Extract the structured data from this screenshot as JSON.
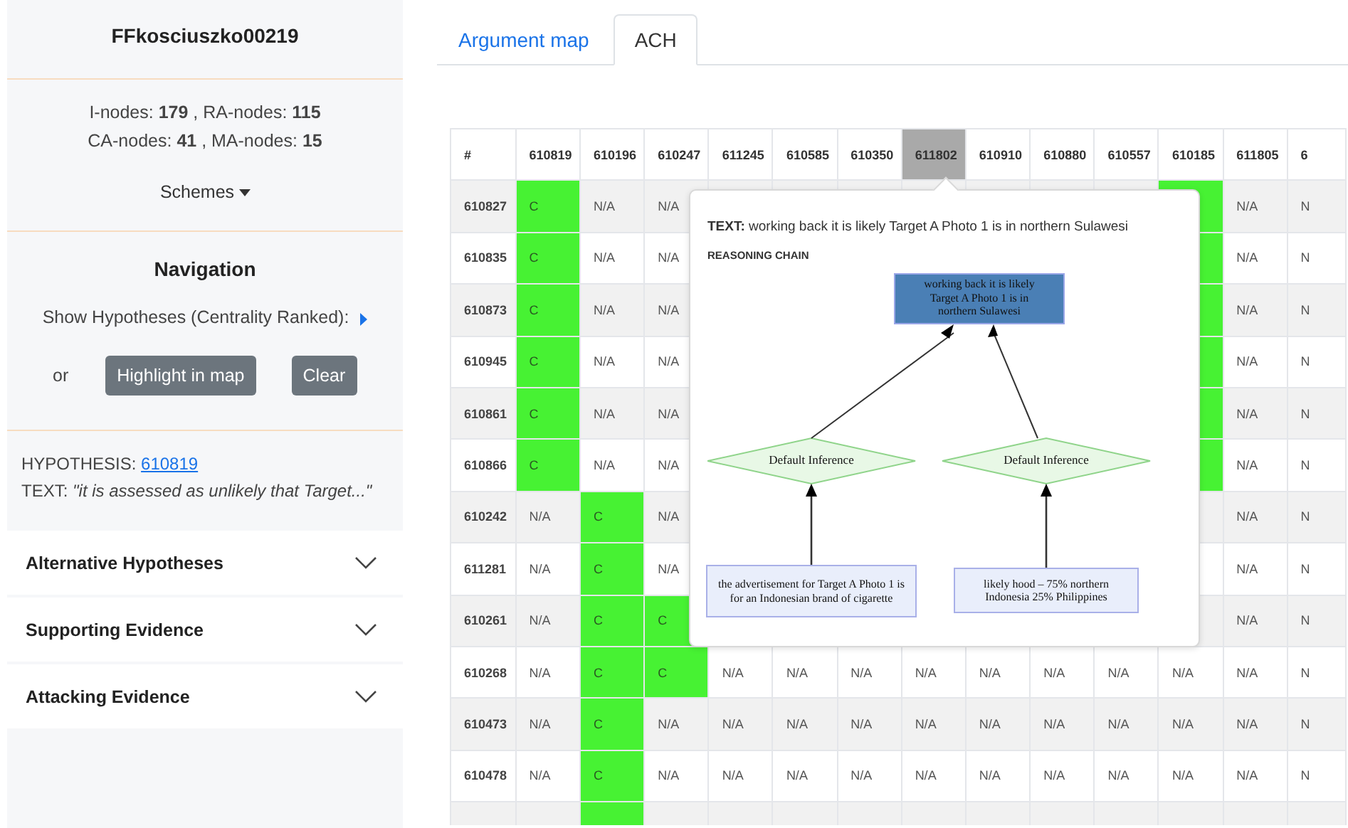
{
  "sidebar": {
    "title": "FFkosciuszko00219",
    "stats": [
      "I-nodes: **179** , RA-nodes: **115**",
      "CA-nodes: **41** , MA-nodes: **15**"
    ],
    "schemes_label": "Schemes",
    "navigation": {
      "heading": "Navigation",
      "show_label": "Show Hypotheses (Centrality Ranked):",
      "or_label": "or",
      "buttons": [
        "Highlight in map",
        "Clear"
      ]
    },
    "hypothesis": {
      "label": "HYPOTHESIS:",
      "id": "610819",
      "text": "TEXT: *\"it is assessed as unlikely that Target...\"*"
    },
    "accordion": [
      {
        "title": "Alternative Hypotheses",
        "expanded": false
      },
      {
        "title": "Supporting Evidence",
        "expanded": false
      },
      {
        "title": "Attacking Evidence",
        "expanded": false
      }
    ]
  },
  "tabs": [
    {
      "label": "Argument map",
      "selected": false
    },
    {
      "label": "ACH",
      "selected": true
    }
  ],
  "ach_table": {
    "corner_label": "#",
    "columns": [
      {
        "label": "610819",
        "selected": false
      },
      {
        "label": "610196",
        "selected": false
      },
      {
        "label": "610247",
        "selected": false
      },
      {
        "label": "611245",
        "selected": false
      },
      {
        "label": "610585",
        "selected": false
      },
      {
        "label": "610350",
        "selected": false
      },
      {
        "label": "611802",
        "selected": true
      },
      {
        "label": "610910",
        "selected": false
      },
      {
        "label": "610880",
        "selected": false
      },
      {
        "label": "610557",
        "selected": false
      },
      {
        "label": "610185",
        "selected": false
      },
      {
        "label": "611805",
        "selected": false
      },
      {
        "label": "6",
        "selected": false
      }
    ],
    "rows": [
      {
        "id": "610827",
        "cells": [
          {
            "text": "C",
            "match": true
          },
          {
            "text": "N/A",
            "match": false
          },
          {
            "text": "N/A",
            "match": false
          },
          null,
          null,
          null,
          null,
          null,
          null,
          null,
          {
            "match": true
          },
          {
            "text": "N/A",
            "match": false
          },
          {
            "text": "N",
            "match": false
          }
        ]
      },
      {
        "id": "610835",
        "cells": [
          {
            "text": "C",
            "match": true
          },
          {
            "text": "N/A",
            "match": false
          },
          {
            "text": "N/A",
            "match": false
          },
          null,
          null,
          null,
          null,
          null,
          null,
          null,
          {
            "match": true
          },
          {
            "text": "N/A",
            "match": false
          },
          {
            "text": "N",
            "match": false
          }
        ]
      },
      {
        "id": "610873",
        "cells": [
          {
            "text": "C",
            "match": true
          },
          {
            "text": "N/A",
            "match": false
          },
          {
            "text": "N/A",
            "match": false
          },
          null,
          null,
          null,
          null,
          null,
          null,
          null,
          {
            "match": true
          },
          {
            "text": "N/A",
            "match": false
          },
          {
            "text": "N",
            "match": false
          }
        ]
      },
      {
        "id": "610945",
        "cells": [
          {
            "text": "C",
            "match": true
          },
          {
            "text": "N/A",
            "match": false
          },
          {
            "text": "N/A",
            "match": false
          },
          null,
          null,
          null,
          null,
          null,
          null,
          null,
          {
            "match": true
          },
          {
            "text": "N/A",
            "match": false
          },
          {
            "text": "N",
            "match": false
          }
        ]
      },
      {
        "id": "610861",
        "cells": [
          {
            "text": "C",
            "match": true
          },
          {
            "text": "N/A",
            "match": false
          },
          {
            "text": "N/A",
            "match": false
          },
          null,
          null,
          null,
          null,
          null,
          null,
          null,
          {
            "match": true
          },
          {
            "text": "N/A",
            "match": false
          },
          {
            "text": "N",
            "match": false
          }
        ]
      },
      {
        "id": "610866",
        "cells": [
          {
            "text": "C",
            "match": true
          },
          {
            "text": "N/A",
            "match": false
          },
          {
            "text": "N/A",
            "match": false
          },
          null,
          null,
          null,
          null,
          null,
          null,
          null,
          {
            "match": true
          },
          {
            "text": "N/A",
            "match": false
          },
          {
            "text": "N",
            "match": false
          }
        ]
      },
      {
        "id": "610242",
        "cells": [
          {
            "text": "N/A",
            "match": false
          },
          {
            "text": "C",
            "match": true
          },
          {
            "text": "N/A",
            "match": false
          },
          null,
          null,
          null,
          null,
          null,
          null,
          null,
          null,
          {
            "text": "N/A",
            "match": false
          },
          {
            "text": "N",
            "match": false
          }
        ]
      },
      {
        "id": "611281",
        "cells": [
          {
            "text": "N/A",
            "match": false
          },
          {
            "text": "C",
            "match": true
          },
          {
            "text": "N/A",
            "match": false
          },
          null,
          null,
          null,
          null,
          null,
          null,
          null,
          null,
          {
            "text": "N/A",
            "match": false
          },
          {
            "text": "N",
            "match": false
          }
        ]
      },
      {
        "id": "610261",
        "cells": [
          {
            "text": "N/A",
            "match": false
          },
          {
            "text": "C",
            "match": true
          },
          {
            "text": "C",
            "match": true
          },
          null,
          null,
          null,
          null,
          null,
          null,
          null,
          null,
          {
            "text": "N/A",
            "match": false
          },
          {
            "text": "N",
            "match": false
          }
        ]
      },
      {
        "id": "610268",
        "cells": [
          {
            "text": "N/A",
            "match": false
          },
          {
            "text": "C",
            "match": true
          },
          {
            "text": "C",
            "match": true
          },
          {
            "text": "N/A",
            "match": false
          },
          {
            "text": "N/A",
            "match": false
          },
          {
            "text": "N/A",
            "match": false
          },
          {
            "text": "N/A",
            "match": false
          },
          {
            "text": "N/A",
            "match": false
          },
          {
            "text": "N/A",
            "match": false
          },
          {
            "text": "N/A",
            "match": false
          },
          {
            "text": "N/A",
            "match": false
          },
          {
            "text": "N/A",
            "match": false
          },
          {
            "text": "N",
            "match": false
          }
        ]
      },
      {
        "id": "610473",
        "cells": [
          {
            "text": "N/A",
            "match": false
          },
          {
            "text": "C",
            "match": true
          },
          {
            "text": "N/A",
            "match": false
          },
          {
            "text": "N/A",
            "match": false
          },
          {
            "text": "N/A",
            "match": false
          },
          {
            "text": "N/A",
            "match": false
          },
          {
            "text": "N/A",
            "match": false
          },
          {
            "text": "N/A",
            "match": false
          },
          {
            "text": "N/A",
            "match": false
          },
          {
            "text": "N/A",
            "match": false
          },
          {
            "text": "N/A",
            "match": false
          },
          {
            "text": "N/A",
            "match": false
          },
          {
            "text": "N",
            "match": false
          }
        ]
      },
      {
        "id": "610478",
        "cells": [
          {
            "text": "N/A",
            "match": false
          },
          {
            "text": "C",
            "match": true
          },
          {
            "text": "N/A",
            "match": false
          },
          {
            "text": "N/A",
            "match": false
          },
          {
            "text": "N/A",
            "match": false
          },
          {
            "text": "N/A",
            "match": false
          },
          {
            "text": "N/A",
            "match": false
          },
          {
            "text": "N/A",
            "match": false
          },
          {
            "text": "N/A",
            "match": false
          },
          {
            "text": "N/A",
            "match": false
          },
          {
            "text": "N/A",
            "match": false
          },
          {
            "text": "N/A",
            "match": false
          },
          {
            "text": "N",
            "match": false
          }
        ]
      },
      {
        "cells": [
          {
            "match": false
          },
          {
            "match": true
          },
          {
            "match": false
          },
          {
            "match": false
          },
          {
            "match": false
          },
          {
            "match": false
          },
          {
            "match": false
          },
          {
            "match": false
          },
          {
            "match": false
          },
          {
            "match": false
          },
          {
            "match": false
          },
          {
            "match": false
          },
          {
            "match": false
          }
        ]
      }
    ]
  },
  "popover": {
    "text": "**TEXT:** working back it is likely Target A Photo 1 is in northern Sulawesi",
    "heading": "REASONING CHAIN",
    "conclusion": "working back it is likely Target A Photo 1 is in northern Sulawesi",
    "inferences": [
      {
        "label": "Default Inference",
        "premise": "the advertisement for Target A Photo 1 is for an Indonesian brand of cigarette"
      },
      {
        "label": "Default Inference",
        "premise": "likely hood – 75% northern Indonesia 25% Philippines"
      }
    ]
  }
}
